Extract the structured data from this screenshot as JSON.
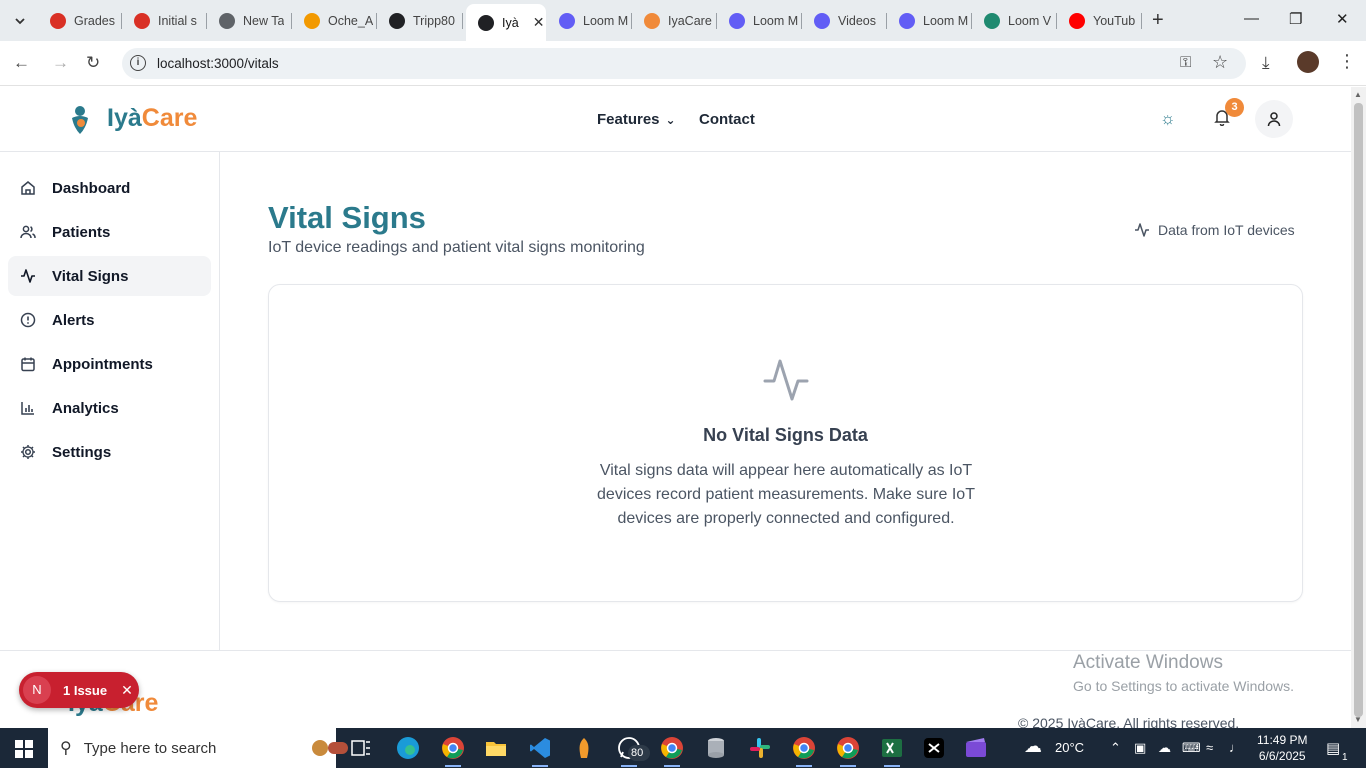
{
  "browser": {
    "tabs": [
      {
        "label": "Grades",
        "color": "#d93025"
      },
      {
        "label": "Initial s",
        "color": "#d93025"
      },
      {
        "label": "New Ta",
        "color": "#5f6368"
      },
      {
        "label": "Oche_A",
        "color": "#f29900"
      },
      {
        "label": "Tripp80",
        "color": "#202124"
      },
      {
        "label": "Iyà",
        "color": "#202124"
      },
      {
        "label": "Loom M",
        "color": "#625df5"
      },
      {
        "label": "IyaCare",
        "color": "#f08a3a"
      },
      {
        "label": "Loom M",
        "color": "#625df5"
      },
      {
        "label": "Videos",
        "color": "#625df5"
      },
      {
        "label": "Loom M",
        "color": "#625df5"
      },
      {
        "label": "Loom V",
        "color": "#1f8a70"
      },
      {
        "label": "YouTub",
        "color": "#ff0000"
      }
    ],
    "active_tab_index": 5,
    "url": "localhost:3000/vitals"
  },
  "header": {
    "logo_part1": "Iyà",
    "logo_part2": "Care",
    "nav_features": "Features",
    "nav_contact": "Contact",
    "notification_count": "3"
  },
  "sidebar": {
    "items": [
      {
        "label": "Dashboard",
        "icon": "home-icon"
      },
      {
        "label": "Patients",
        "icon": "users-icon"
      },
      {
        "label": "Vital Signs",
        "icon": "activity-icon"
      },
      {
        "label": "Alerts",
        "icon": "alert-circle-icon"
      },
      {
        "label": "Appointments",
        "icon": "calendar-icon"
      },
      {
        "label": "Analytics",
        "icon": "bar-chart-icon"
      },
      {
        "label": "Settings",
        "icon": "gear-icon"
      }
    ],
    "active_index": 2
  },
  "main": {
    "title": "Vital Signs",
    "subtitle": "IoT device readings and patient vital signs monitoring",
    "iot_note": "Data from IoT devices",
    "empty_title": "No Vital Signs Data",
    "empty_description": "Vital signs data will appear here automatically as IoT devices record patient measurements. Make sure IoT devices are properly connected and configured."
  },
  "footer": {
    "logo_part1": "Iyà",
    "logo_part2": "Care",
    "copyright": "© 2025 IyàCare. All rights reserved."
  },
  "dev_overlay": {
    "badge_letter": "N",
    "issue_label": "1 Issue"
  },
  "windows_watermark": {
    "line1": "Activate Windows",
    "line2": "Go to Settings to activate Windows."
  },
  "taskbar": {
    "search_placeholder": "Type here to search",
    "whatsapp_badge": "80",
    "weather": "20°C",
    "time": "11:49 PM",
    "date": "6/6/2025",
    "notification_count": "1"
  },
  "colors": {
    "brand_teal": "#2b7a8c",
    "brand_orange": "#f08a3a",
    "issue_red": "#c8202f"
  }
}
